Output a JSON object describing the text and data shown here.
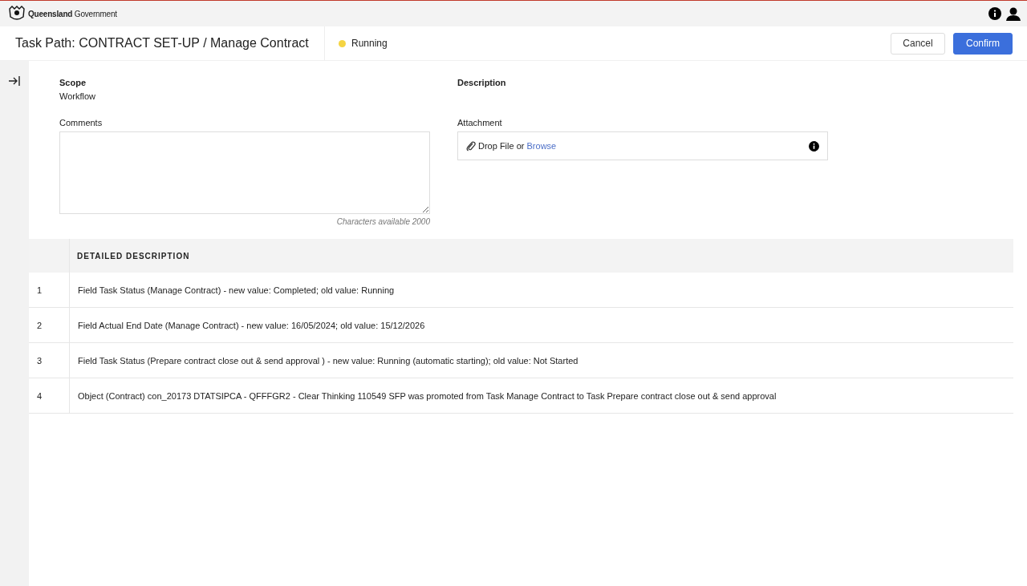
{
  "topbar": {
    "logo_text_bold": "Queensland",
    "logo_text": "Government"
  },
  "header": {
    "title": "Task Path: CONTRACT SET-UP / Manage Contract",
    "status": "Running",
    "buttons": [
      {
        "label": "Cancel",
        "kind": "secondary"
      },
      {
        "label": "Confirm",
        "kind": "primary"
      }
    ]
  },
  "form": {
    "scope_label": "Scope",
    "scope_value": "Workflow",
    "description_label": "Description",
    "comments_label": "Comments",
    "characters_available": "Characters available 2000",
    "attachment_label": "Attachment",
    "drop_text": "Drop File or",
    "browse_link": "Browse"
  },
  "table": {
    "columns": [
      "DETAILED DESCRIPTION"
    ],
    "rows": [
      {
        "number": "1",
        "text": "Field Task Status (Manage Contract) - new value: Completed; old value: Running"
      },
      {
        "number": "2",
        "text": "Field Actual End Date (Manage Contract) - new value: 16/05/2024; old value: 15/12/2026"
      },
      {
        "number": "3",
        "text": "Field Task Status (Prepare contract close out & send approval ) - new value: Running (automatic starting); old value: Not Started"
      },
      {
        "number": "4",
        "text": "Object (Contract) con_20173 DTATSIPCA - QFFFGR2 - Clear Thinking 110549 SFP was promoted from Task Manage Contract to Task Prepare contract close out & send approval"
      }
    ]
  }
}
